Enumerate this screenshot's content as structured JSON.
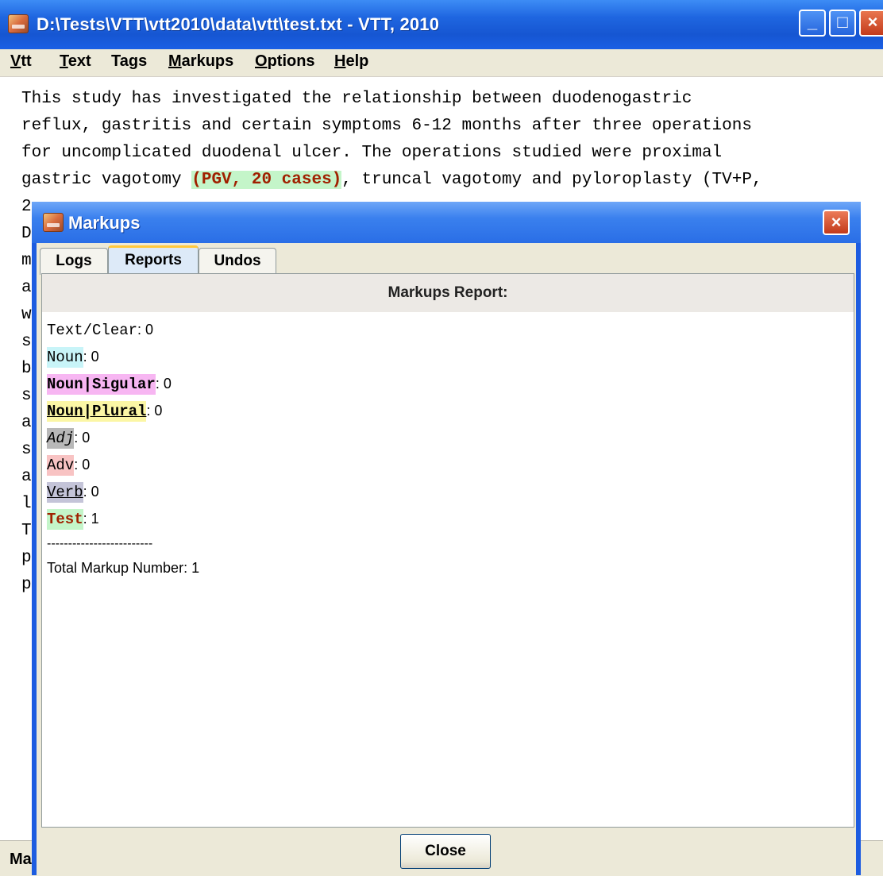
{
  "window": {
    "title": "D:\\Tests\\VTT\\vtt2010\\data\\vtt\\test.txt - VTT, 2010",
    "minimize_glyph": "_",
    "maximize_glyph": "□",
    "close_glyph": "×"
  },
  "menu": [
    {
      "mnemonic": "V",
      "rest": "tt"
    },
    {
      "mnemonic": "T",
      "rest": "ext"
    },
    {
      "pre": "Ta",
      "mnemonic": "g",
      "rest": "s"
    },
    {
      "mnemonic": "M",
      "rest": "arkups"
    },
    {
      "mnemonic": "O",
      "rest": "ptions"
    },
    {
      "mnemonic": "H",
      "rest": "elp"
    }
  ],
  "editor": {
    "line1": "This study has investigated the relationship between duodenogastric",
    "line2": "reflux, gastritis and certain symptoms 6-12 months after three operations",
    "line3": "for uncomplicated duodenal ulcer. The operations studied were proximal",
    "line4_pre": "gastric vagotomy ",
    "line4_hl": "(PGV, 20 cases)",
    "line4_post": ", truncal vagotomy and pyloroplasty (TV+P,",
    "left_chars": [
      "2",
      "D",
      "m",
      "a",
      "w",
      "s",
      "b",
      "s",
      "a",
      "s",
      "a",
      "l",
      "T",
      "p",
      "p"
    ]
  },
  "status": {
    "text": "Ma"
  },
  "dialog": {
    "title": "Markups",
    "close_glyph": "×",
    "tabs": [
      "Logs",
      "Reports",
      "Undos"
    ],
    "active_tab": "Reports",
    "header": "Markups Report:",
    "rows": [
      {
        "label": "Text/Clear",
        "value": ": 0"
      },
      {
        "label": "Noun",
        "value": ": 0"
      },
      {
        "label": "Noun|Sigular",
        "value": ": 0"
      },
      {
        "label": "Noun|Plural",
        "value": ": 0"
      },
      {
        "label": "Adj",
        "value": ": 0"
      },
      {
        "label": "Adv",
        "value": ": 0"
      },
      {
        "label": "Verb",
        "value": ": 0"
      },
      {
        "label": "Test",
        "value": ": 1"
      }
    ],
    "separator": "-------------------------",
    "total": "Total Markup Number: 1",
    "close_button": "Close"
  },
  "colors": {
    "titlebar": "#1f66e0",
    "noun": "#c8f4f8",
    "noun_singular": "#f7b6f2",
    "noun_plural": "#fbf6a5",
    "adj": "#b8b8b8",
    "adv": "#f8c3c3",
    "verb": "#c4c4d8",
    "test": "#c4f5c9",
    "test_text": "#a02000"
  }
}
